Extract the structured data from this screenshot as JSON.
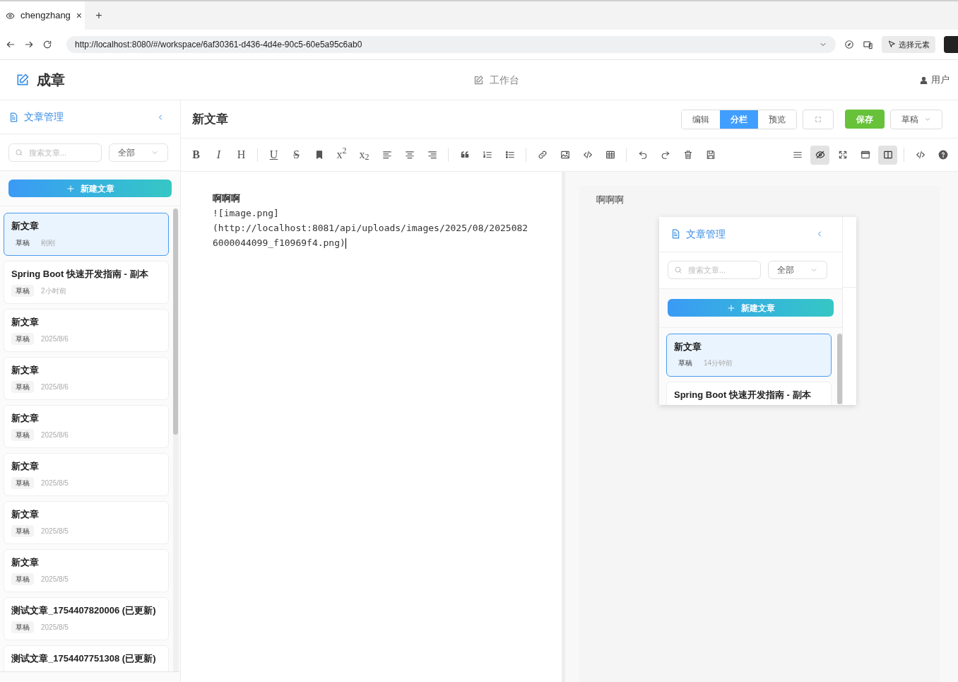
{
  "browser": {
    "tab": {
      "title": "chengzhang",
      "close": "×"
    },
    "new_tab": "+",
    "url": "http://localhost:8080/#/workspace/6af30361-d436-4d4e-90c5-60e5a95c6ab0",
    "inspect_button": "选择元素"
  },
  "app_header": {
    "logo": "成章",
    "nav": "工作台",
    "user": "用户"
  },
  "sidebar": {
    "title": "文章管理",
    "search": {
      "placeholder": "搜索文章..."
    },
    "filter": "全部",
    "new_button": "新建文章",
    "items": [
      {
        "title": "新文章",
        "status": "草稿",
        "time": "刚刚",
        "selected": true
      },
      {
        "title": "Spring Boot 快速开发指南 - 副本",
        "status": "草稿",
        "time": "2小时前",
        "selected": false
      },
      {
        "title": "新文章",
        "status": "草稿",
        "time": "2025/8/6",
        "selected": false
      },
      {
        "title": "新文章",
        "status": "草稿",
        "time": "2025/8/6",
        "selected": false
      },
      {
        "title": "新文章",
        "status": "草稿",
        "time": "2025/8/6",
        "selected": false
      },
      {
        "title": "新文章",
        "status": "草稿",
        "time": "2025/8/5",
        "selected": false
      },
      {
        "title": "新文章",
        "status": "草稿",
        "time": "2025/8/5",
        "selected": false
      },
      {
        "title": "新文章",
        "status": "草稿",
        "time": "2025/8/5",
        "selected": false
      },
      {
        "title": "测试文章_1754407820006 (已更新)",
        "status": "草稿",
        "time": "2025/8/5",
        "selected": false
      },
      {
        "title": "测试文章_1754407751308 (已更新)",
        "selected": false
      }
    ]
  },
  "editor": {
    "title": "新文章",
    "modes": [
      {
        "label": "编辑",
        "selected": false
      },
      {
        "label": "分栏",
        "selected": true
      },
      {
        "label": "预览",
        "selected": false
      }
    ],
    "save": "保存",
    "status": "草稿",
    "toolbar_groups": [
      [
        {
          "kind": "bold",
          "text": "B"
        },
        {
          "kind": "italic",
          "text": "I"
        },
        {
          "kind": "heading",
          "text": "H"
        }
      ],
      [
        {
          "kind": "underline",
          "text": "U"
        },
        {
          "kind": "strike",
          "text": "S"
        },
        {
          "kind": "bookmark"
        },
        {
          "kind": "sup",
          "text": "x$^{2}$"
        },
        {
          "kind": "sub",
          "text": "x$_{2}$"
        },
        {
          "kind": "align-left"
        },
        {
          "kind": "align-center"
        },
        {
          "kind": "align-right"
        }
      ],
      [
        {
          "kind": "quote"
        },
        {
          "kind": "ordered-list"
        },
        {
          "kind": "bullet-list"
        }
      ],
      [
        {
          "kind": "link"
        },
        {
          "kind": "image"
        },
        {
          "kind": "code"
        },
        {
          "kind": "table"
        }
      ],
      [
        {
          "kind": "undo"
        },
        {
          "kind": "redo"
        },
        {
          "kind": "trash"
        },
        {
          "kind": "save"
        }
      ]
    ],
    "view_toggles": [
      {
        "kind": "menu",
        "selected": false
      },
      {
        "kind": "eye-off",
        "selected": true
      },
      {
        "kind": "fullscreen",
        "selected": false
      },
      {
        "kind": "window",
        "selected": false
      },
      {
        "kind": "columns",
        "selected": true
      }
    ],
    "toolbar_extra": [
      {
        "kind": "code"
      },
      {
        "kind": "help"
      }
    ],
    "lines": [
      "啊啊啊",
      "![image.png]",
      "(http://localhost:8081/api/uploads/images/2025/08/2025082",
      "6000044099_f10969f4.png)"
    ]
  },
  "preview": {
    "text": "啊啊啊",
    "image": {
      "title": "文章管理",
      "search_placeholder": "搜索文章...",
      "filter": "全部",
      "new_button": "新建文章",
      "items": [
        {
          "title": "新文章",
          "status": "草稿",
          "time": "14分钟前",
          "selected": true
        },
        {
          "title": "Spring Boot 快速开发指南 - 副本",
          "selected": false
        }
      ]
    }
  }
}
